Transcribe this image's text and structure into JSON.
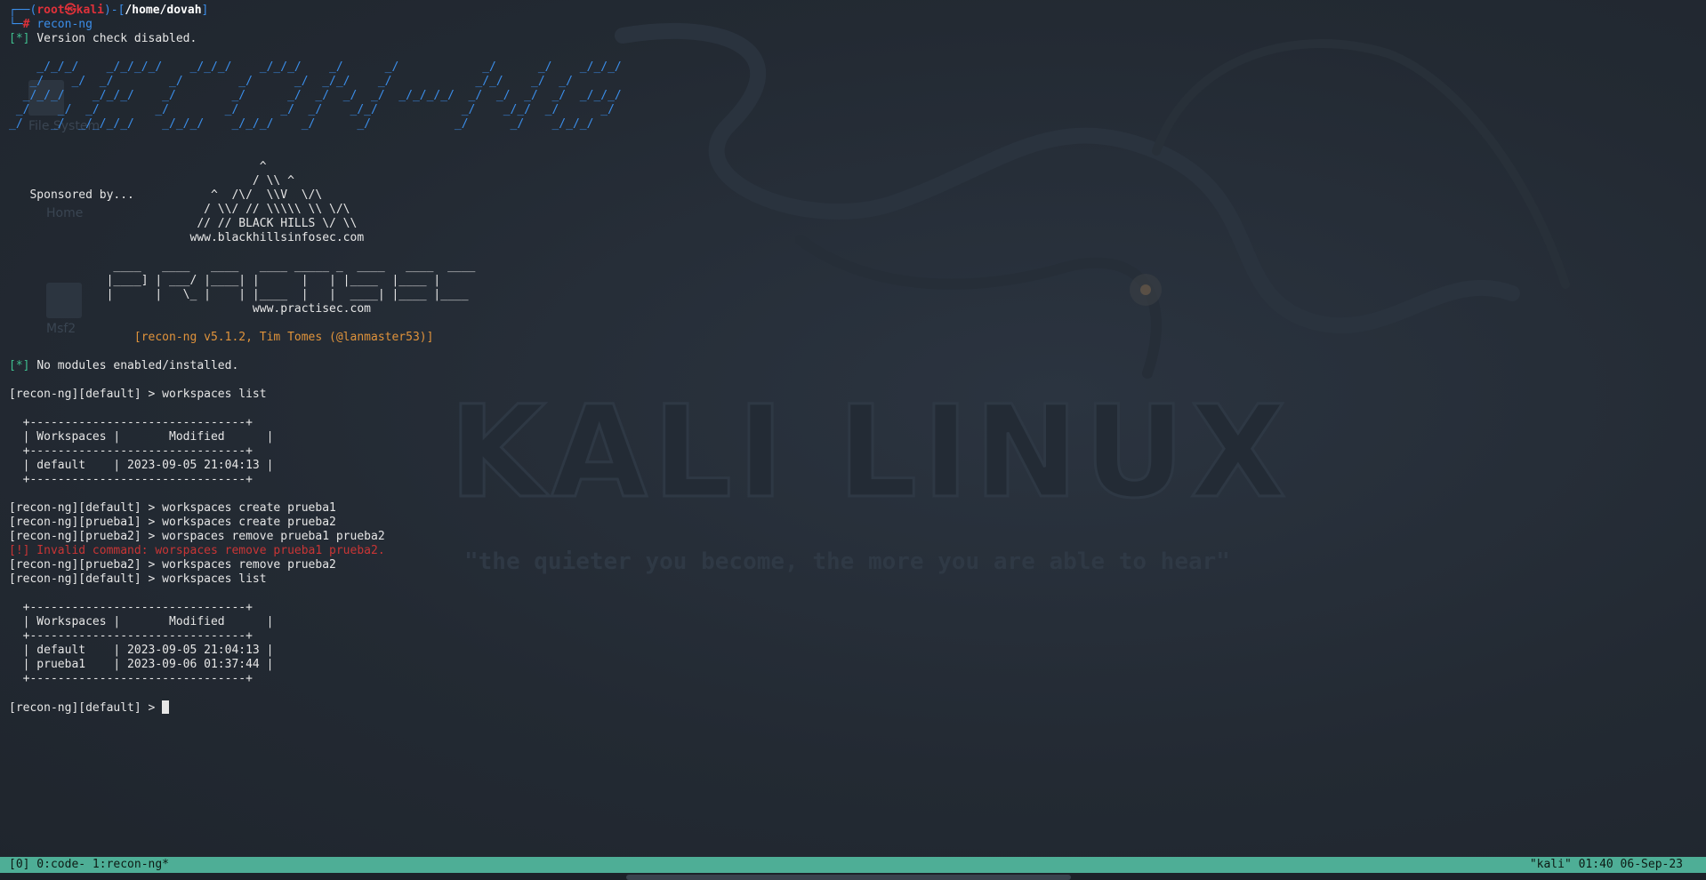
{
  "prompt": {
    "corner_top": "┌──(",
    "user": "root㉿kali",
    "paren_close": ")-[",
    "path": "/home/dovah",
    "bracket_close": "]",
    "corner_bottom": "└─",
    "hash": "#",
    "command": "recon-ng"
  },
  "info_tag": "[*]",
  "warn_tag": "[!]",
  "version_msg": "Version check disabled.",
  "banner": [
    "    _/_/_/    _/_/_/_/    _/_/_/    _/_/_/    _/      _/            _/      _/    _/_/_/",
    "   _/    _/  _/        _/        _/      _/  _/_/    _/            _/_/    _/  _/       ",
    "  _/_/_/    _/_/_/    _/        _/      _/  _/  _/  _/  _/_/_/_/  _/  _/  _/  _/  _/_/_/",
    " _/    _/  _/        _/        _/      _/  _/    _/_/            _/    _/_/  _/      _/ ",
    "_/    _/  _/_/_/_/    _/_/_/    _/_/_/    _/      _/            _/      _/    _/_/_/    "
  ],
  "bhis_art": [
    "                                    ^",
    "                                   / \\\\ ^",
    "   Sponsored by...           ^  /\\/  \\\\V  \\/\\",
    "                            / \\\\/ // \\\\\\\\\\ \\\\ \\/\\",
    "                           // // BLACK HILLS \\/ \\\\",
    "                          www.blackhillsinfosec.com"
  ],
  "practisec_art": [
    "               ____   ____   ____   ____ _____ _  ____   ____  ____",
    "              |____] | ___/ |____| |      |   | |____  |____ |",
    "              |      |   \\_ |    | |____  |   |  ____| |____ |____",
    "                                   www.practisec.com"
  ],
  "version_banner": "                  [recon-ng v5.1.2, Tim Tomes (@lanmaster53)]",
  "modules_msg": "No modules enabled/installed.",
  "session": {
    "cmd1": "[recon-ng][default] > workspaces list",
    "table1": [
      "  +-------------------------------+",
      "  | Workspaces |       Modified      |",
      "  +-------------------------------+",
      "  | default    | 2023-09-05 21:04:13 |",
      "  +-------------------------------+"
    ],
    "cmd2": "[recon-ng][default] > workspaces create prueba1",
    "cmd3": "[recon-ng][prueba1] > workspaces create prueba2",
    "cmd4": "[recon-ng][prueba2] > worspaces remove prueba1 prueba2",
    "error": "[!] Invalid command: worspaces remove prueba1 prueba2.",
    "cmd5": "[recon-ng][prueba2] > workspaces remove prueba2",
    "cmd6": "[recon-ng][default] > workspaces list",
    "table2": [
      "  +-------------------------------+",
      "  | Workspaces |       Modified      |",
      "  +-------------------------------+",
      "  | default    | 2023-09-05 21:04:13 |",
      "  | prueba1    | 2023-09-06 01:37:44 |",
      "  +-------------------------------+"
    ],
    "final_prompt": "[recon-ng][default] > "
  },
  "statusbar": {
    "left": "[0] 0:code- 1:recon-ng*",
    "right": "\"kali\" 01:40 06-Sep-23"
  },
  "wallpaper": {
    "title": "KALI LINUX",
    "quote": "\"the quieter you become, the more you are able to hear\""
  },
  "desktop_icons": [
    "File System",
    "Home",
    "Msf2"
  ],
  "colors": {
    "prompt_blue": "#3b8eea",
    "prompt_red": "#e0313a",
    "info_cyan": "#2fb8c4",
    "error_red": "#c93535",
    "orange": "#e0933b",
    "statusbar": "#4eae96"
  }
}
